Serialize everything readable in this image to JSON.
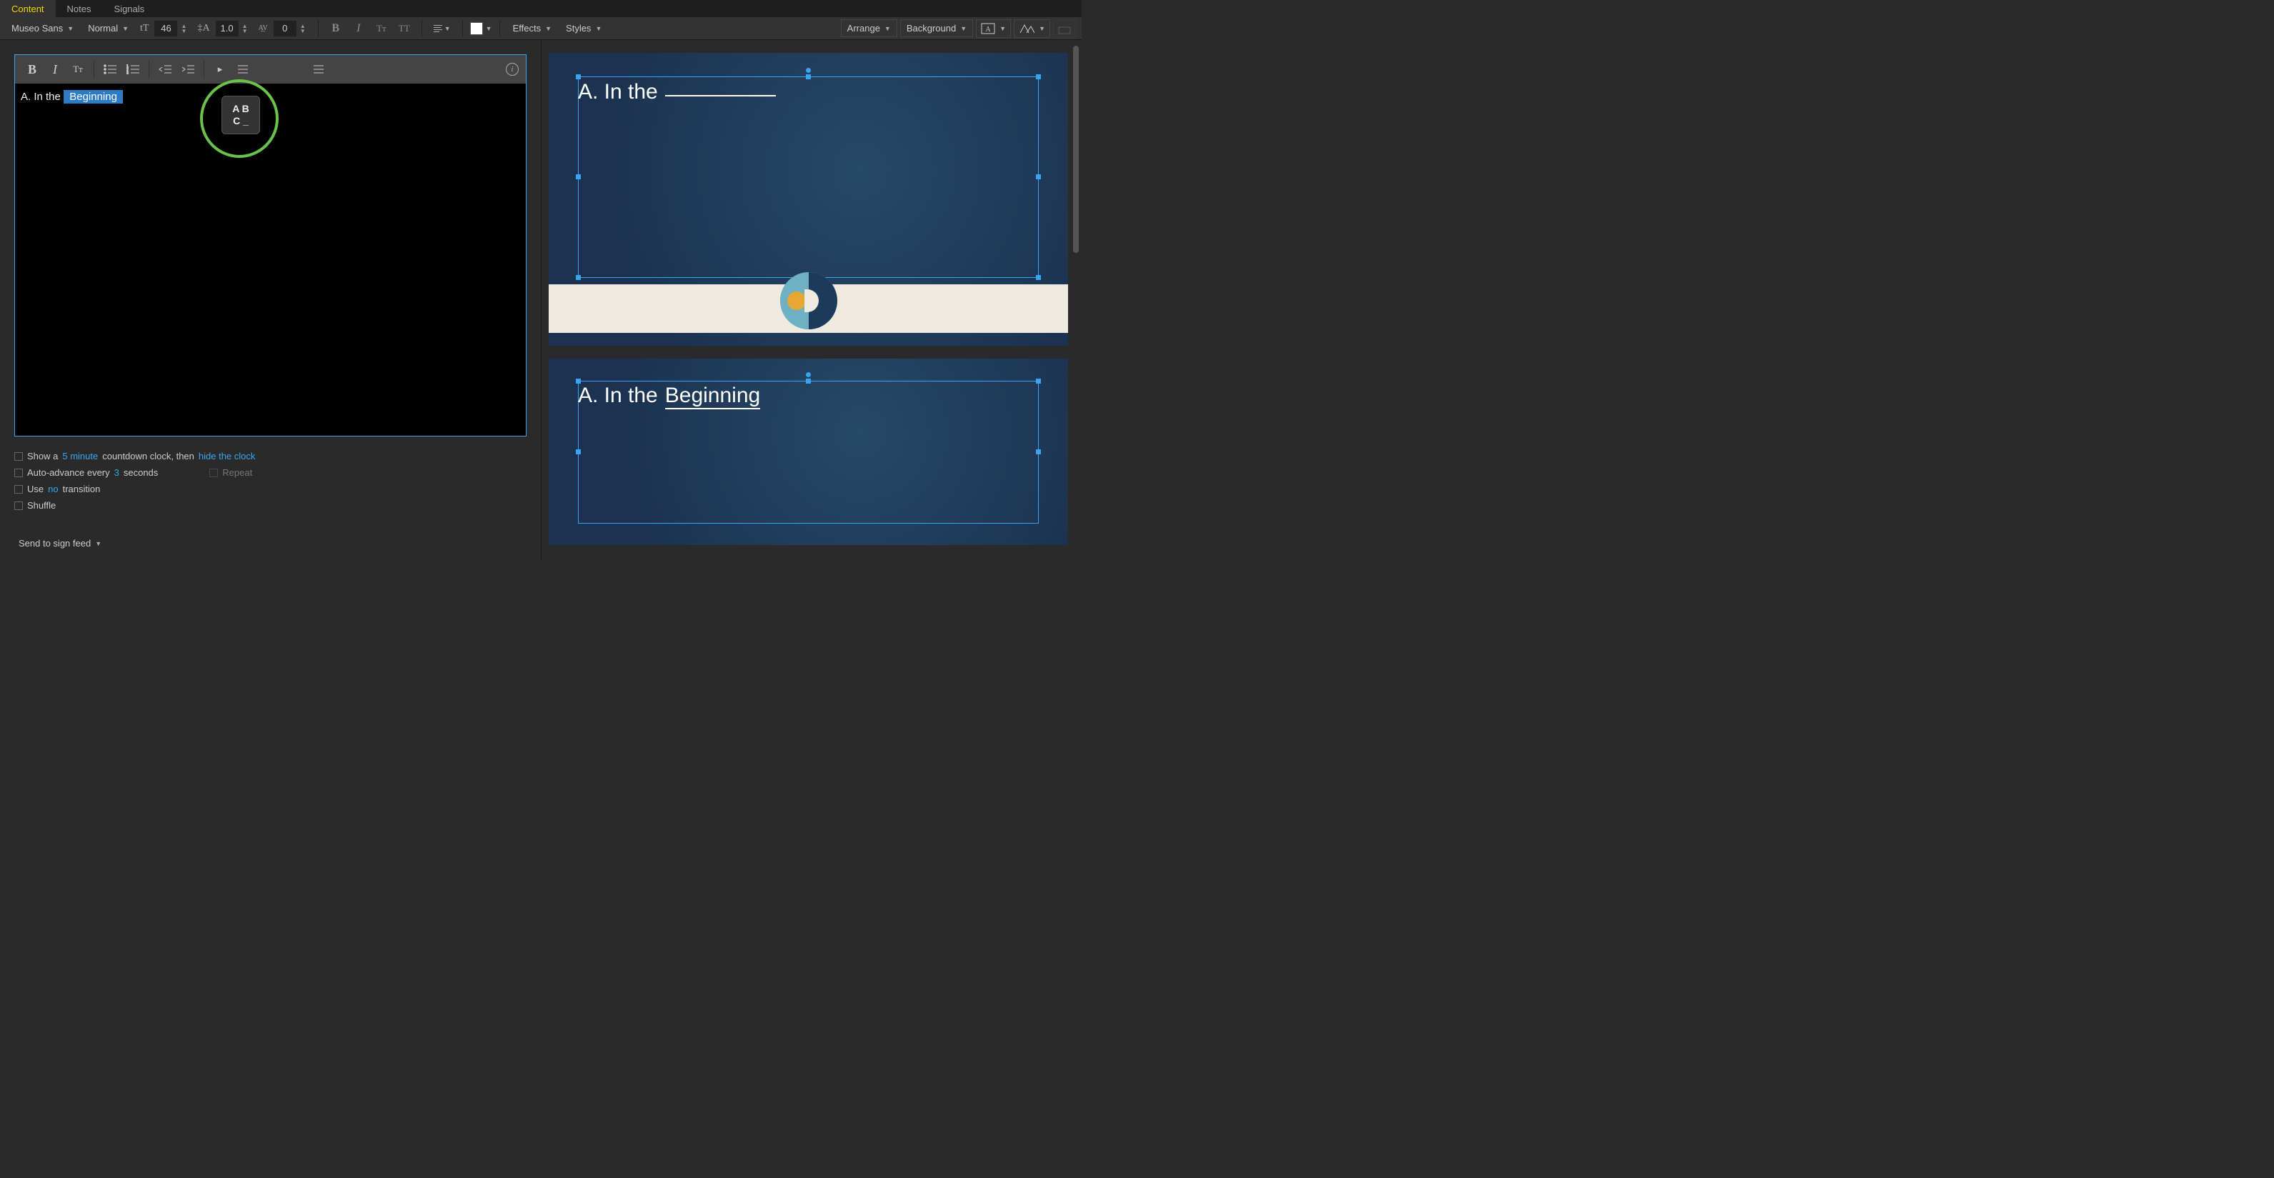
{
  "tabs": {
    "content": "Content",
    "notes": "Notes",
    "signals": "Signals"
  },
  "propbar": {
    "font": "Museo Sans",
    "weight": "Normal",
    "size": "46",
    "lineheight": "1.0",
    "tracking": "0",
    "bold": "B",
    "italic": "I",
    "tt1": "TT",
    "tt2": "TT",
    "effects": "Effects",
    "styles": "Styles",
    "arrange": "Arrange",
    "background": "Background"
  },
  "editor": {
    "line_prefix": "A. In the ",
    "highlight": "Beginning",
    "abc_top": "A B",
    "abc_bot": "C _"
  },
  "options": {
    "show_a": "Show a",
    "dur": "5 minute",
    "countdown_tail": "countdown clock, then",
    "hide": "hide the clock",
    "autoadv": "Auto-advance every",
    "autoadv_n": "3",
    "autoadv_tail": "seconds",
    "repeat": "Repeat",
    "use": "Use",
    "no": "no",
    "transition": "transition",
    "shuffle": "Shuffle",
    "send": "Send to sign feed"
  },
  "slides": {
    "s1_prefix": "A. In the",
    "s2_prefix": "A. In the",
    "s2_word": "Beginning"
  }
}
